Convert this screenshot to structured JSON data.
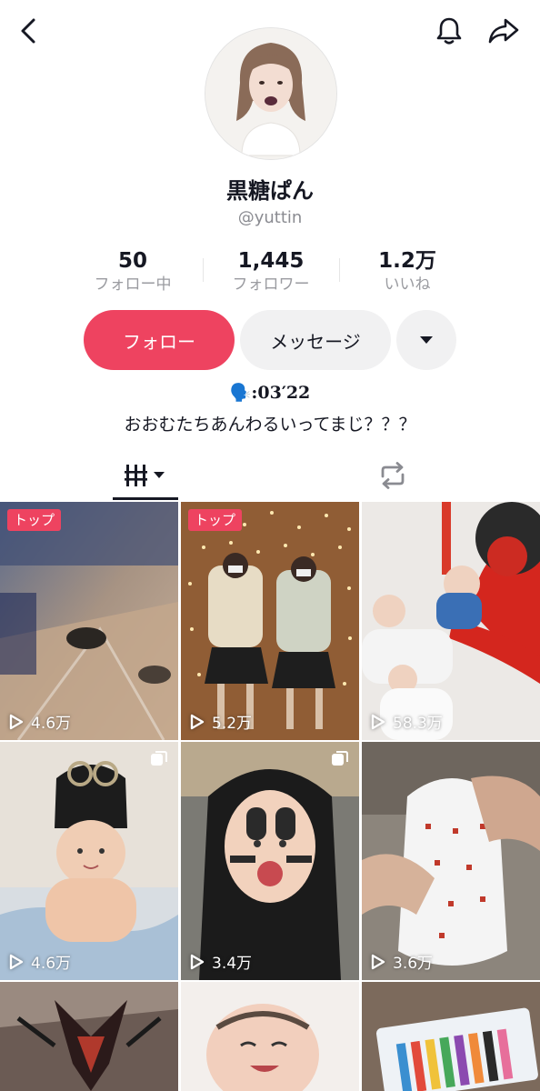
{
  "header": {
    "back_icon": "chevron-left-icon",
    "bell_icon": "bell-icon",
    "share_icon": "share-arrow-icon"
  },
  "profile": {
    "name": "黒糖ぱん",
    "handle": "@yuttin",
    "stats": [
      {
        "value": "50",
        "label": "フォロー中"
      },
      {
        "value": "1,445",
        "label": "フォロワー"
      },
      {
        "value": "1.2万",
        "label": "いいね"
      }
    ],
    "follow_label": "フォロー",
    "message_label": "メッセージ",
    "bio_line1": "🗣️:03′22",
    "bio_line2": "おおむたちあんわるいってまじ？？？"
  },
  "tabs": [
    {
      "icon": "video-grid-icon",
      "active": true
    },
    {
      "icon": "repost-icon",
      "active": false
    }
  ],
  "videos": [
    {
      "badge": "トップ",
      "views": "4.6万",
      "multi": false
    },
    {
      "badge": "トップ",
      "views": "5.2万",
      "multi": false
    },
    {
      "badge": "",
      "views": "58.3万",
      "multi": false
    },
    {
      "badge": "",
      "views": "4.6万",
      "multi": true
    },
    {
      "badge": "",
      "views": "3.4万",
      "multi": true
    },
    {
      "badge": "",
      "views": "3.6万",
      "multi": false
    },
    {
      "badge": "",
      "views": "",
      "multi": false
    },
    {
      "badge": "",
      "views": "",
      "multi": false
    },
    {
      "badge": "",
      "views": "",
      "multi": false
    }
  ],
  "colors": {
    "accent": "#ee4360",
    "text": "#161823",
    "muted": "#8a8b91",
    "button_bg": "#f1f1f2"
  }
}
